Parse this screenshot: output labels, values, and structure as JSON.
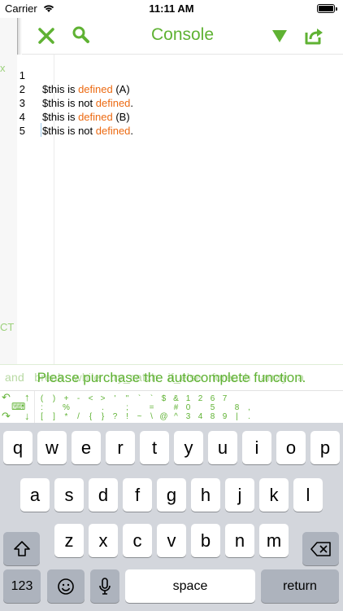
{
  "status_bar": {
    "carrier": "Carrier",
    "time": "11:11 AM"
  },
  "sidebar": {
    "top_fragment": "x",
    "bottom_fragment": "CT"
  },
  "navbar": {
    "title": "Console"
  },
  "editor": {
    "lines": [
      {
        "number": "1",
        "parts": [
          "$this is ",
          "defined",
          " (A)"
        ]
      },
      {
        "number": "2",
        "parts": [
          "$this is not ",
          "defined",
          "."
        ]
      },
      {
        "number": "3",
        "parts": [
          "$this is ",
          "defined",
          " (B)"
        ]
      },
      {
        "number": "4",
        "parts": [
          "$this is not ",
          "defined",
          "."
        ]
      },
      {
        "number": "5",
        "parts": [
          "",
          "",
          ""
        ]
      }
    ]
  },
  "hint_bar": {
    "background_suggestions": "and   break   while   try_catch   if_else   foreach   array   a",
    "message": "Please purchase the autocomplete function."
  },
  "symbol_bar": {
    "top_row": [
      "(",
      ")",
      "+",
      "-",
      "<",
      ">",
      "'",
      "\"",
      "`",
      "`",
      "$",
      "&",
      "1",
      "2",
      "6",
      "7",
      "",
      ""
    ],
    "middle_row": [
      ":",
      "",
      "%",
      "",
      "",
      ".",
      "",
      ";",
      "",
      "=",
      "",
      "#",
      "0",
      "",
      "5",
      "",
      "8",
      ","
    ],
    "bottom_row": [
      "[",
      "]",
      "*",
      "/",
      "{",
      "}",
      "?",
      "!",
      "~",
      "\\",
      "@",
      "^",
      "3",
      "4",
      "8",
      "9",
      "|",
      "."
    ]
  },
  "keyboard": {
    "row1": [
      "q",
      "w",
      "e",
      "r",
      "t",
      "y",
      "u",
      "i",
      "o",
      "p"
    ],
    "row2": [
      "a",
      "s",
      "d",
      "f",
      "g",
      "h",
      "j",
      "k",
      "l"
    ],
    "row3": [
      "z",
      "x",
      "c",
      "v",
      "b",
      "n",
      "m"
    ],
    "numbers_label": "123",
    "space_label": "space",
    "return_label": "return"
  },
  "colors": {
    "accent": "#5fb233",
    "keyword": "#ec6a12",
    "keyboard_bg": "#d3d6dc"
  }
}
